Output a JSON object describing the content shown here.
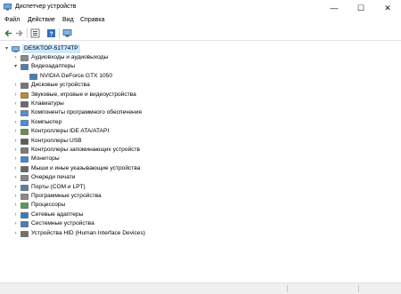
{
  "window": {
    "title": "Диспетчер устройств",
    "minimize": "—",
    "maximize": "☐",
    "close": "✕"
  },
  "menu": [
    "Файл",
    "Действие",
    "Вид",
    "Справка"
  ],
  "toolbar": [
    "back-icon",
    "forward-icon",
    "properties-icon",
    "help-icon",
    "monitor-icon"
  ],
  "tree": {
    "root": "DESKTOP-51T74TP",
    "items": [
      {
        "label": "Аудиовходы и аудиовыходы",
        "icon": "speaker-icon",
        "expanded": false
      },
      {
        "label": "Видеоадаптеры",
        "icon": "display-adapter-icon",
        "expanded": true
      },
      {
        "label": "NVIDIA GeForce GTX 1050",
        "icon": "display-adapter-icon",
        "child": true
      },
      {
        "label": "Дисковые устройства",
        "icon": "disk-icon",
        "expanded": false
      },
      {
        "label": "Звуковые, игровые и видеоустройства",
        "icon": "sound-icon",
        "expanded": false
      },
      {
        "label": "Клавиатуры",
        "icon": "keyboard-icon",
        "expanded": false
      },
      {
        "label": "Компоненты программного обеспечения",
        "icon": "component-icon",
        "expanded": false
      },
      {
        "label": "Компьютер",
        "icon": "computer-icon",
        "expanded": false
      },
      {
        "label": "Контроллеры IDE ATA/ATAPI",
        "icon": "ide-icon",
        "expanded": false
      },
      {
        "label": "Контроллеры USB",
        "icon": "usb-icon",
        "expanded": false
      },
      {
        "label": "Контроллеры запоминающих устройств",
        "icon": "storage-icon",
        "expanded": false
      },
      {
        "label": "Мониторы",
        "icon": "monitor-icon",
        "expanded": false
      },
      {
        "label": "Мыши и иные указывающие устройства",
        "icon": "mouse-icon",
        "expanded": false
      },
      {
        "label": "Очереди печати",
        "icon": "printer-icon",
        "expanded": false
      },
      {
        "label": "Порты (COM и LPT)",
        "icon": "port-icon",
        "expanded": false
      },
      {
        "label": "Программные устройства",
        "icon": "software-device-icon",
        "expanded": false
      },
      {
        "label": "Процессоры",
        "icon": "processor-icon",
        "expanded": false
      },
      {
        "label": "Сетевые адаптеры",
        "icon": "network-icon",
        "expanded": false
      },
      {
        "label": "Системные устройства",
        "icon": "system-icon",
        "expanded": false
      },
      {
        "label": "Устройства HID (Human Interface Devices)",
        "icon": "hid-icon",
        "expanded": false
      }
    ]
  }
}
